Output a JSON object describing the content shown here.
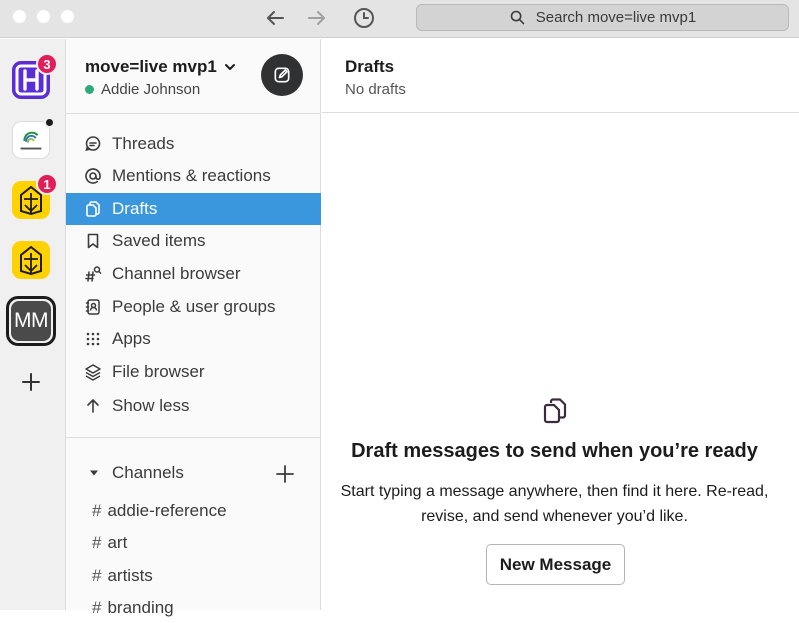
{
  "titlebar": {
    "search_placeholder": "Search move=live mvp1"
  },
  "rail": {
    "workspaces": [
      {
        "name": "H",
        "badge": "3",
        "color": "#5b2fd6"
      },
      {
        "name": "Citizens' Climate Lobby",
        "dot": true
      },
      {
        "name": "Sunrise",
        "badge": "1",
        "color": "#ffd200"
      },
      {
        "name": "Sunrise",
        "color": "#ffd200"
      },
      {
        "name": "MM",
        "selected": true
      }
    ],
    "mm_label": "MM"
  },
  "sidebar": {
    "workspace_name": "move=live mvp1",
    "user_name": "Addie Johnson",
    "nav": [
      {
        "label": "Threads",
        "icon": "threads-icon"
      },
      {
        "label": "Mentions & reactions",
        "icon": "at-icon"
      },
      {
        "label": "Drafts",
        "icon": "drafts-icon",
        "active": true
      },
      {
        "label": "Saved items",
        "icon": "bookmark-icon"
      },
      {
        "label": "Channel browser",
        "icon": "channel-search-icon"
      },
      {
        "label": "People & user groups",
        "icon": "contacts-icon"
      },
      {
        "label": "Apps",
        "icon": "apps-grid-icon"
      },
      {
        "label": "File browser",
        "icon": "layers-icon"
      },
      {
        "label": "Show less",
        "icon": "arrow-up-icon"
      }
    ],
    "channels_label": "Channels",
    "channels": [
      {
        "name": "addie-reference"
      },
      {
        "name": "art"
      },
      {
        "name": "artists"
      },
      {
        "name": "branding"
      }
    ],
    "hash": "#"
  },
  "main": {
    "title": "Drafts",
    "subtitle": "No drafts",
    "empty_title": "Draft messages to send when you’re ready",
    "empty_body": "Start typing a message anywhere, then find it here. Re-read, revise, and send whenever you’d like.",
    "new_message_label": "New Message"
  },
  "colors": {
    "active_nav": "#3a96dd",
    "presence": "#2bac76",
    "badge": "#e01e5a"
  }
}
